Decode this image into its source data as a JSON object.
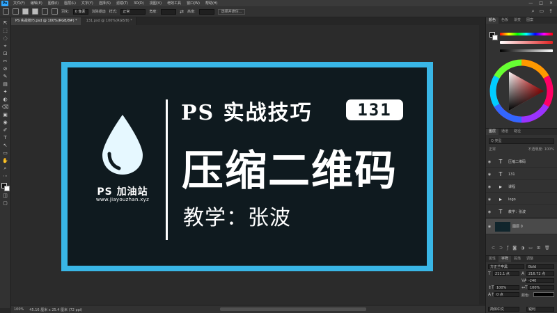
{
  "app": {
    "logo": "Ps",
    "menu": [
      "文件(F)",
      "编辑(E)",
      "图像(I)",
      "图层(L)",
      "文字(Y)",
      "选择(S)",
      "滤镜(T)",
      "3D(D)",
      "视图(V)",
      "增效工具",
      "窗口(W)",
      "帮助(H)"
    ],
    "window_controls": [
      "—",
      "□",
      "✕"
    ]
  },
  "options_bar": {
    "feather_label": "羽化:",
    "feather_value": "0 像素",
    "antialias_label": "消除锯齿",
    "style_label": "样式:",
    "style_value": "正常",
    "width_label": "宽度:",
    "height_label": "高度:",
    "select_mask_button": "选择并遮住..."
  },
  "document_tabs": [
    {
      "label": "PS 实战技巧.psd @ 100%(RGB/8#) *",
      "active": true
    },
    {
      "label": "131.psd @ 100%(RGB/8) *",
      "active": false
    }
  ],
  "tools": [
    "⇱",
    "⬚",
    "◌",
    "⌖",
    "⊡",
    "✂",
    "⊘",
    "✎",
    "▤",
    "✦",
    "◐",
    "⌫",
    "▣",
    "◉",
    "✐",
    "T",
    "↖",
    "▭",
    "✋",
    "⌕",
    "⋯"
  ],
  "canvas": {
    "brand_name": "PS 加油站",
    "brand_url": "www.jiayouzhan.xyz",
    "subtitle": "PS 实战技巧",
    "episode": "131",
    "main_title": "压缩二维码",
    "teacher": "教学：张波"
  },
  "status_bar": {
    "zoom": "100%",
    "doc_info": "45.16 厘米 x 25.4 厘米 (72 ppi)"
  },
  "colors": {
    "frame": "#39b6e6",
    "card_background": "#0f1a1f",
    "drop_fill": "#e6f8ff",
    "text": "#ffffff"
  },
  "panels": {
    "color_tabs": [
      "颜色",
      "色板",
      "渐变",
      "图案"
    ],
    "layers_tabs": [
      "图层",
      "通道",
      "路径"
    ],
    "layers_filter": "Q 类型",
    "layers_blend": "正常",
    "layers_opacity": "不透明度: 100%",
    "layers": [
      {
        "type": "T",
        "name": "压缩二维码",
        "selected": false
      },
      {
        "type": "T",
        "name": "131",
        "selected": false
      },
      {
        "type": "▸",
        "name": "课程",
        "selected": false
      },
      {
        "type": "▸",
        "name": "logo",
        "selected": false
      },
      {
        "type": "T",
        "name": "教学：张波",
        "selected": false
      },
      {
        "type": "▇",
        "name": "图层 0",
        "selected": true
      }
    ],
    "char_tabs": [
      "属性",
      "字符",
      "段落",
      "调整"
    ],
    "char_font": "方正兰亭黑",
    "char_style": "Bold",
    "char_size": "211.1 点",
    "char_leading": "216.72 点",
    "char_tracking": "-240",
    "char_scale_v": "100%",
    "char_scale_h": "100%",
    "char_baseline": "0 点",
    "char_color_label": "颜色:",
    "char_lang": "简体中文",
    "char_aa": "锐利"
  }
}
